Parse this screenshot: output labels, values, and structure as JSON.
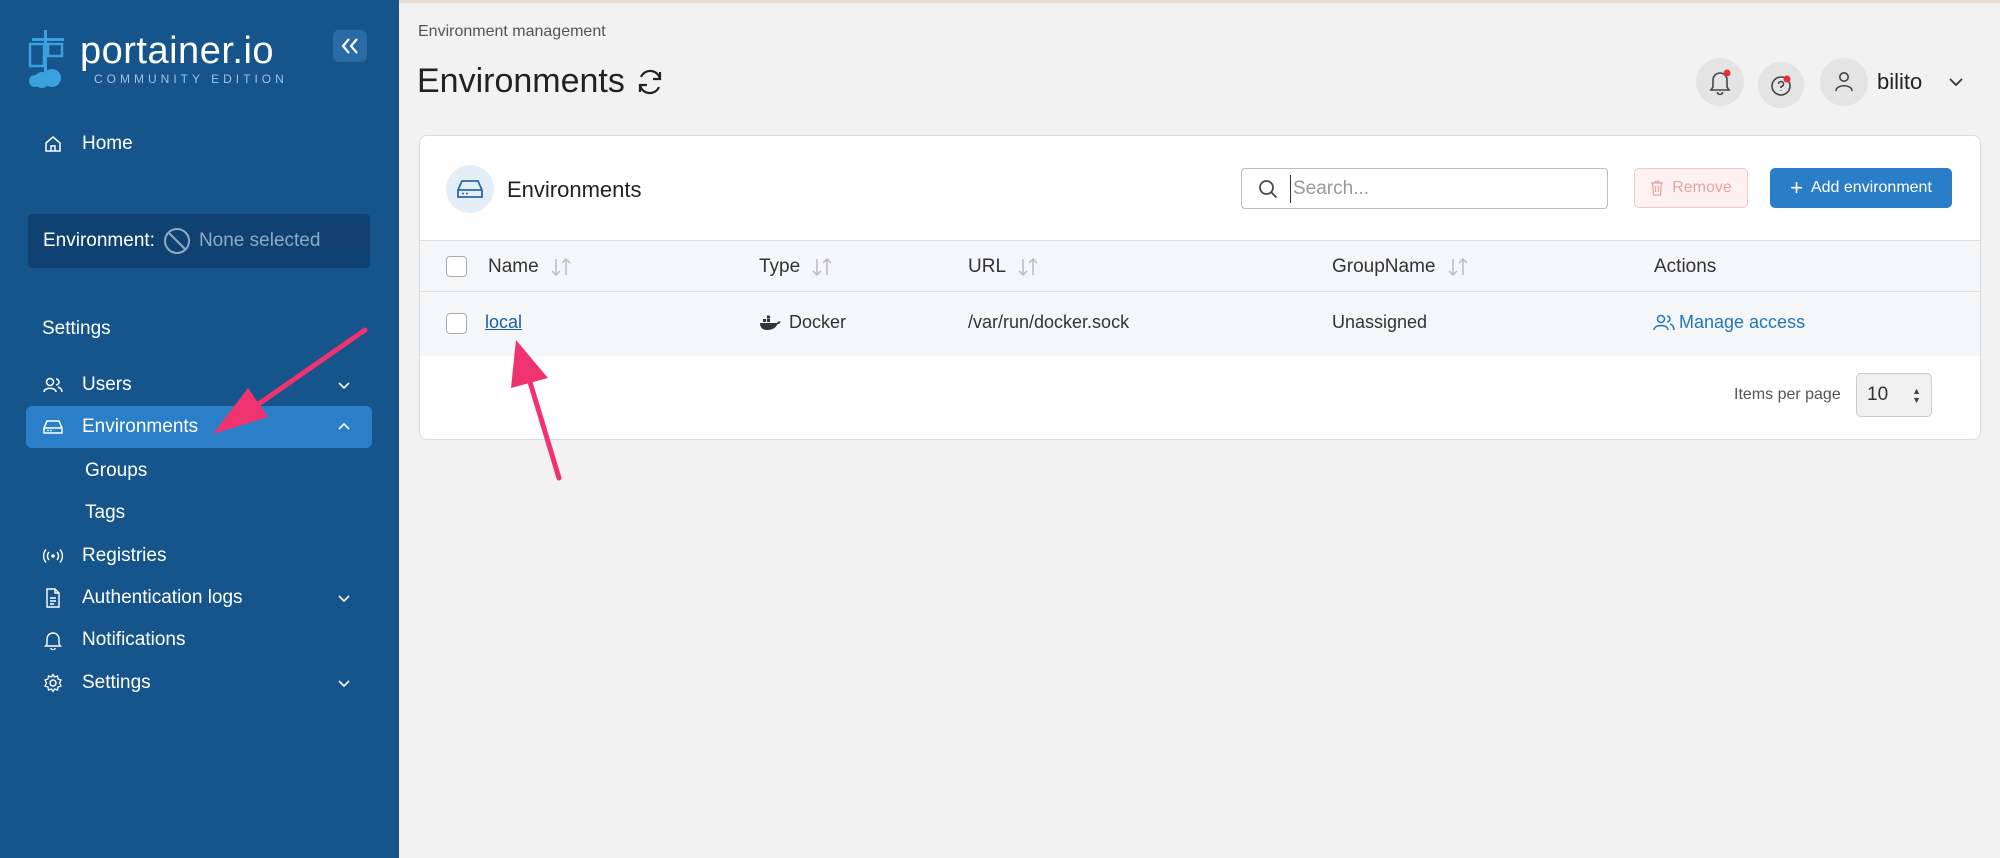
{
  "brand": {
    "name": "portainer.io",
    "edition": "COMMUNITY EDITION"
  },
  "sidebar": {
    "home_label": "Home",
    "environment_label": "Environment:",
    "environment_value": "None selected",
    "section_title": "Settings",
    "items": [
      {
        "label": "Users",
        "icon": "users-icon",
        "expandable": true,
        "expanded": false
      },
      {
        "label": "Environments",
        "icon": "environments-icon",
        "expandable": true,
        "expanded": true,
        "active": true
      },
      {
        "label": "Registries",
        "icon": "registries-icon",
        "expandable": false
      },
      {
        "label": "Authentication logs",
        "icon": "file-icon",
        "expandable": true,
        "expanded": false
      },
      {
        "label": "Notifications",
        "icon": "bell-icon",
        "expandable": false
      },
      {
        "label": "Settings",
        "icon": "gear-icon",
        "expandable": true,
        "expanded": false
      }
    ],
    "sub_items": [
      "Groups",
      "Tags"
    ]
  },
  "header": {
    "breadcrumb": "Environment management",
    "title": "Environments",
    "user": "bilito"
  },
  "panel": {
    "title": "Environments",
    "search_placeholder": "Search...",
    "remove_label": "Remove",
    "add_label": "Add environment",
    "columns": [
      "Name",
      "Type",
      "URL",
      "GroupName",
      "Actions"
    ],
    "rows": [
      {
        "name": "local",
        "type": "Docker",
        "url": "/var/run/docker.sock",
        "group": "Unassigned",
        "action": "Manage access"
      }
    ],
    "items_per_page_label": "Items per page",
    "items_per_page_value": "10"
  },
  "colors": {
    "sidebar_bg": "#16548c",
    "active_item": "#2b7fc9",
    "primary_button": "#2a7dc7",
    "annotation_arrow": "#f0336f"
  }
}
